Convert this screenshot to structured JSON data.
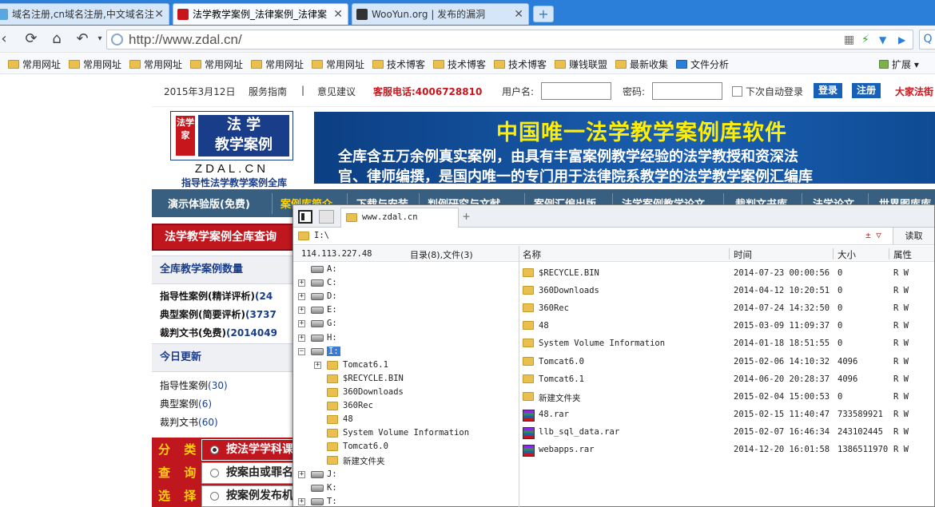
{
  "browser": {
    "tabs": [
      {
        "title": "域名注册,cn域名注册,中文域名注",
        "active": false
      },
      {
        "title": "法学教学案例_法律案例_法律案",
        "active": true
      },
      {
        "title": "WooYun.org | 发布的漏洞",
        "active": false
      }
    ],
    "new_tab": "+",
    "url": "http://www.zdal.cn/",
    "bookmarks": [
      "常用网址",
      "常用网址",
      "常用网址",
      "常用网址",
      "常用网址",
      "常用网址",
      "技术博客",
      "技术博客",
      "技术博客",
      "赚钱联盟",
      "最新收集",
      "文件分析"
    ],
    "extensions_label": "扩展"
  },
  "site": {
    "topline": {
      "date": "2015年3月12日",
      "guide": "服务指南",
      "divider": "|",
      "feedback": "意见建议",
      "hotline": "客服电话:4006728810",
      "username_label": "用户名:",
      "password_label": "密码:",
      "remember": "下次自动登录",
      "login": "登录",
      "register": "注册",
      "slogan": "大家法街"
    },
    "logo": {
      "seal": "法学家",
      "title_line1": "法 学",
      "title_line2": "教学案例",
      "domain": "ZDAL.CN",
      "tagline": "指导性法学教学案例全库"
    },
    "banner": {
      "headline": "中国唯一法学教学案例库软件",
      "line1": "全库含五万余例真实案例，由具有丰富案例教学经验的法学教授和资深法",
      "line2": "官、律师编撰，是国内唯一的专门用于法律院系教学的法学教学案例汇编库"
    },
    "menu": [
      "演示体验版(免费)",
      "案例库简介",
      "下载与安装",
      "判例研究与文献",
      "案例汇编出版",
      "法学案例教学论文",
      "裁判文书库",
      "法学论文",
      "世界图库库"
    ],
    "left": {
      "search_title": "法学教学案例全库查询",
      "count_title": "全库教学案例数量",
      "counts": [
        {
          "label": "指导性案例(精详评析)",
          "value": "(24"
        },
        {
          "label": "典型案例(简要评析)",
          "value": "(3737"
        },
        {
          "label": "裁判文书(免费)",
          "value": "(2014049"
        }
      ],
      "today_title": "今日更新",
      "today": [
        {
          "label": "指导性案例",
          "value": "(30)"
        },
        {
          "label": "典型案例",
          "value": "(6)"
        },
        {
          "label": "裁判文书",
          "value": "(60)"
        }
      ],
      "class_labels": [
        "分 类",
        "查 询",
        "选 择"
      ],
      "class_options": [
        "按法学学科课",
        "按案由或罪名",
        "按案例发布机"
      ]
    }
  },
  "filemanager": {
    "tab_title": "www.zdal.cn",
    "path": "I:\\",
    "read_button": "读取",
    "dropdown": "± ▽",
    "host_ip": "114.113.227.48",
    "summary": "目录(8),文件(3)",
    "columns": [
      "名称",
      "时间",
      "大小",
      "属性"
    ],
    "tree": [
      {
        "label": "A:",
        "type": "drive",
        "pm": ""
      },
      {
        "label": "C:",
        "type": "drive",
        "pm": "+"
      },
      {
        "label": "D:",
        "type": "drive",
        "pm": "+"
      },
      {
        "label": "E:",
        "type": "drive",
        "pm": "+"
      },
      {
        "label": "G:",
        "type": "drive",
        "pm": "+"
      },
      {
        "label": "H:",
        "type": "drive",
        "pm": "+"
      },
      {
        "label": "I:",
        "type": "drive",
        "pm": "-"
      },
      {
        "label": "Tomcat6.1",
        "type": "folder",
        "pm": "+"
      },
      {
        "label": "$RECYCLE.BIN",
        "type": "folder",
        "pm": ""
      },
      {
        "label": "360Downloads",
        "type": "folder",
        "pm": ""
      },
      {
        "label": "360Rec",
        "type": "folder",
        "pm": ""
      },
      {
        "label": "48",
        "type": "folder",
        "pm": ""
      },
      {
        "label": "System Volume Information",
        "type": "folder",
        "pm": ""
      },
      {
        "label": "Tomcat6.0",
        "type": "folder",
        "pm": ""
      },
      {
        "label": "新建文件夹",
        "type": "folder",
        "pm": ""
      },
      {
        "label": "J:",
        "type": "drive",
        "pm": "+"
      },
      {
        "label": "K:",
        "type": "drive",
        "pm": ""
      },
      {
        "label": "T:",
        "type": "drive",
        "pm": "+"
      }
    ],
    "files": [
      {
        "name": "$RECYCLE.BIN",
        "time": "2014-07-23 00:00:56",
        "size": "0",
        "attr": "R W",
        "type": "folder"
      },
      {
        "name": "360Downloads",
        "time": "2014-04-12 10:20:51",
        "size": "0",
        "attr": "R W",
        "type": "folder"
      },
      {
        "name": "360Rec",
        "time": "2014-07-24 14:32:50",
        "size": "0",
        "attr": "R W",
        "type": "folder"
      },
      {
        "name": "48",
        "time": "2015-03-09 11:09:37",
        "size": "0",
        "attr": "R W",
        "type": "folder"
      },
      {
        "name": "System Volume Information",
        "time": "2014-01-18 18:51:55",
        "size": "0",
        "attr": "R W",
        "type": "folder"
      },
      {
        "name": "Tomcat6.0",
        "time": "2015-02-06 14:10:32",
        "size": "4096",
        "attr": "R W",
        "type": "folder"
      },
      {
        "name": "Tomcat6.1",
        "time": "2014-06-20 20:28:37",
        "size": "4096",
        "attr": "R W",
        "type": "folder"
      },
      {
        "name": "新建文件夹",
        "time": "2015-02-04 15:00:53",
        "size": "0",
        "attr": "R W",
        "type": "folder"
      },
      {
        "name": "48.rar",
        "time": "2015-02-15 11:40:47",
        "size": "733589921",
        "attr": "R W",
        "type": "rar"
      },
      {
        "name": "llb_sql_data.rar",
        "time": "2015-02-07 16:46:34",
        "size": "243102445",
        "attr": "R W",
        "type": "rar"
      },
      {
        "name": "webapps.rar",
        "time": "2014-12-20 16:01:58",
        "size": "1386511970",
        "attr": "R W",
        "type": "rar"
      }
    ]
  }
}
